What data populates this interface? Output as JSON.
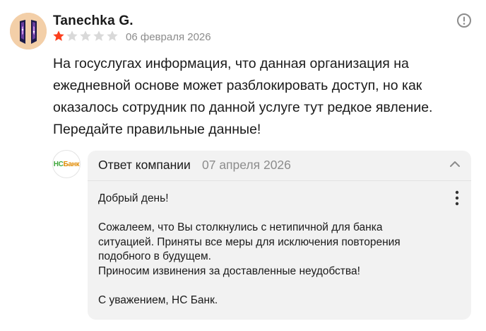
{
  "review": {
    "author": "Tanechka G.",
    "rating": 1,
    "max_rating": 5,
    "date": "06 февраля 2026",
    "text_lines": [
      "На госуслугах информация, что данная организация на",
      "ежедневной основе может разблокировать доступ, но как",
      "оказалось сотрудник по данной услуге тут редкое явление.",
      "Передайте правильные данные!"
    ]
  },
  "company": {
    "logo_hc": "НС",
    "logo_bank": "Банк"
  },
  "reply": {
    "title": "Ответ компании",
    "date": "07 апреля 2026",
    "greeting": "Добрый день!",
    "paragraph_lines": [
      "Сожалеем, что Вы столкнулись с нетипичной для банка",
      "ситуацией. Приняты все меры для исключения повторения",
      "подобного в будущем.",
      "Приносим извинения за доставленные неудобства!"
    ],
    "signature": "С уважением, НС Банк."
  },
  "icons": {
    "report": "alert-circle-icon",
    "collapse": "chevron-up-icon",
    "menu": "more-vertical-icon",
    "star": "star-icon"
  },
  "colors": {
    "star_filled": "#fc3f1d",
    "star_empty": "#d9d9d9",
    "muted_text": "#8c8c8c",
    "reply_background": "#f2f2f2",
    "logo_green": "#3ea63a",
    "logo_orange": "#e08a00"
  }
}
